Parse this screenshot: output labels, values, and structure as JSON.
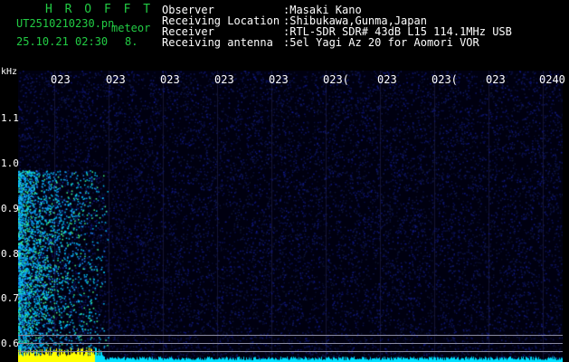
{
  "header": {
    "title": "H R O F F T",
    "filename": "UT2510210230.pn",
    "meteor_label": "meteor",
    "datetime": "25.10.21 02:30",
    "count": "8.",
    "info_labels": [
      "Observer",
      "Receiving Location",
      "Receiver",
      "Receiving antenna"
    ],
    "info_values": [
      ":Masaki Kano",
      ":Shibukawa,Gunma,Japan",
      ":RTL-SDR SDR# 43dB L15 114.1MHz USB",
      ":5el Yagi Az 20 for Aomori VOR"
    ]
  },
  "spectrogram": {
    "unit_label": "kHz",
    "time_ticks": [
      "023",
      "023",
      "023",
      "023",
      "023",
      "023(",
      "023",
      "023(",
      "023",
      "0240"
    ],
    "freq_ticks": [
      "1.1",
      "1.0",
      "0.9",
      "0.8",
      "0.7",
      "0.6"
    ],
    "colors": {
      "background": "#000010",
      "noise": "#1a2aa0",
      "signal": "#00e0ff",
      "strong": "#ffff00"
    }
  }
}
